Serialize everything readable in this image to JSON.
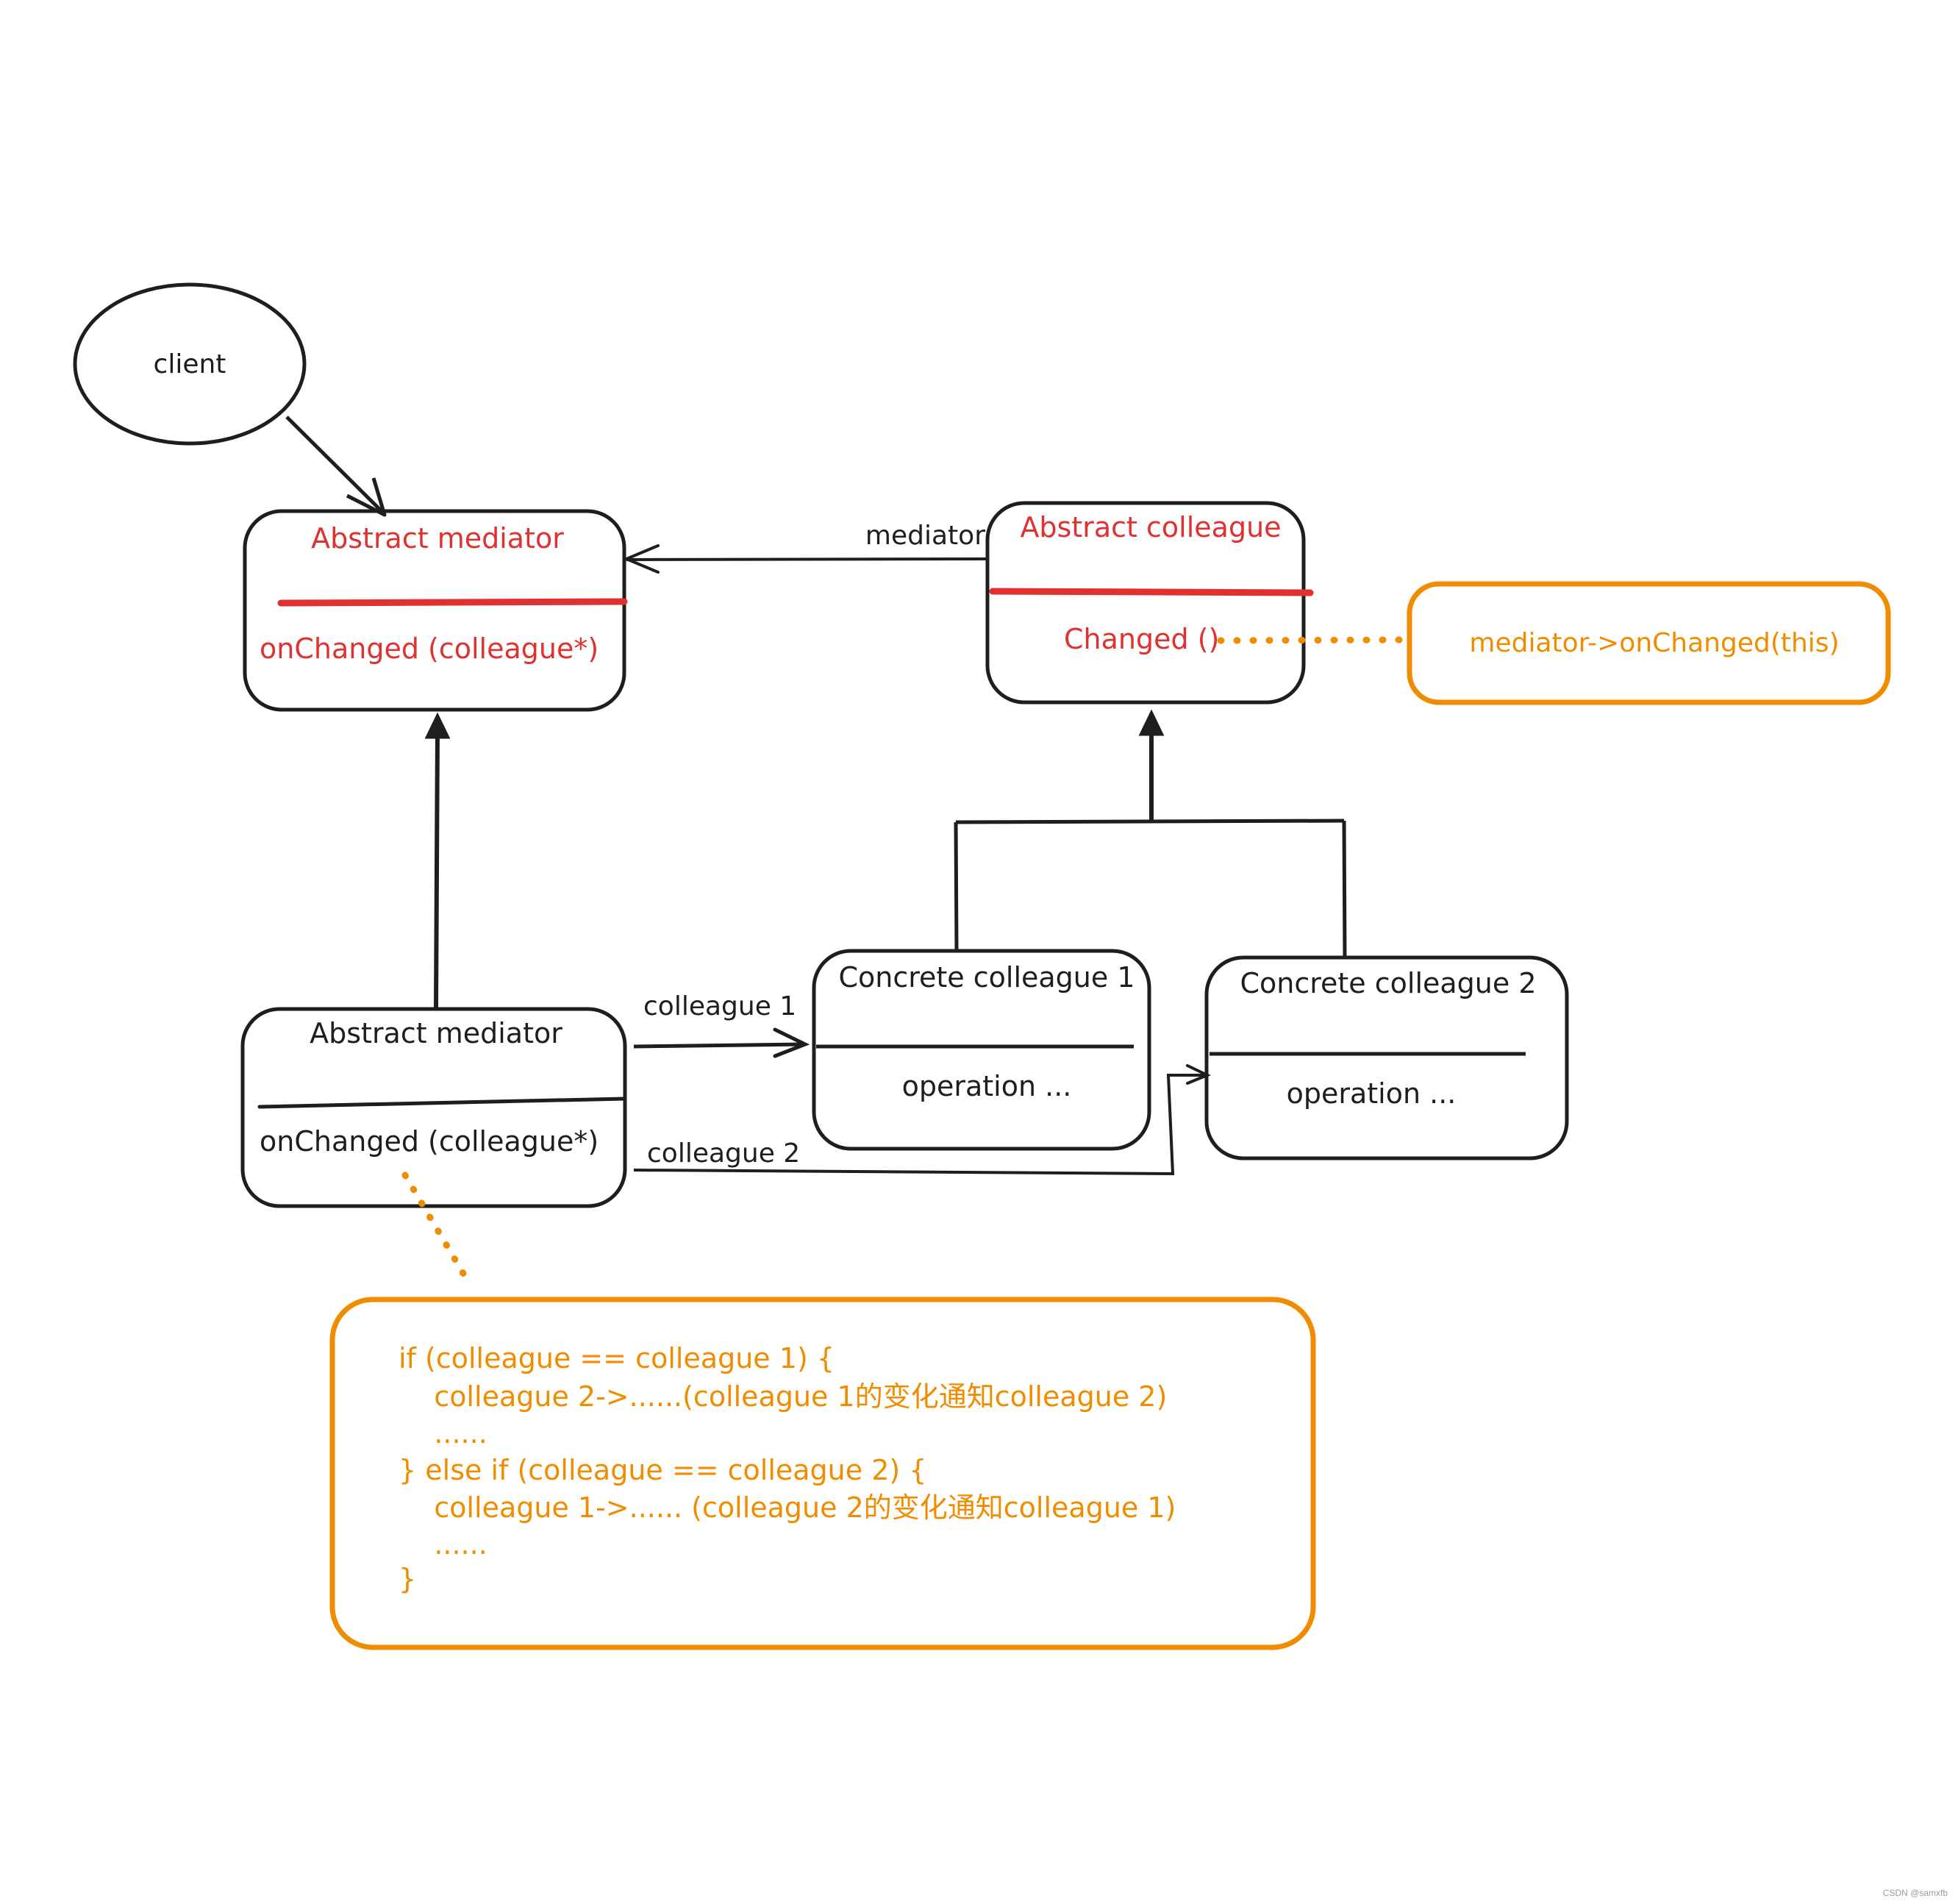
{
  "colors": {
    "ink": "#1e1e1e",
    "red": "#e03131",
    "orange": "#f08c00",
    "background": "#ffffff"
  },
  "client": {
    "label": "client"
  },
  "abstract_mediator_top": {
    "title": "Abstract mediator",
    "method": "onChanged (colleague*)"
  },
  "abstract_colleague": {
    "title": "Abstract colleague",
    "method": "Changed ()"
  },
  "mediator_link_label": "mediator",
  "note_changed": {
    "text": "mediator->onChanged(this)"
  },
  "abstract_mediator_bottom": {
    "title": "Abstract mediator",
    "method": "onChanged (colleague*)"
  },
  "concrete_colleague_1": {
    "title": "Concrete colleague 1",
    "method": "operation ..."
  },
  "concrete_colleague_2": {
    "title": "Concrete colleague 2",
    "method": "operation ..."
  },
  "link_colleague_1_label": "colleague 1",
  "link_colleague_2_label": "colleague 2",
  "note_onchanged": {
    "lines": [
      "if (colleague == colleague 1) {",
      "    colleague 2->......(colleague 1的变化通知colleague 2)",
      "    ......",
      "} else if (colleague == colleague 2) {",
      "    colleague 1->...... (colleague 2的变化通知colleague 1)",
      "    ......",
      "}"
    ]
  },
  "watermark": "CSDN @samxfb"
}
